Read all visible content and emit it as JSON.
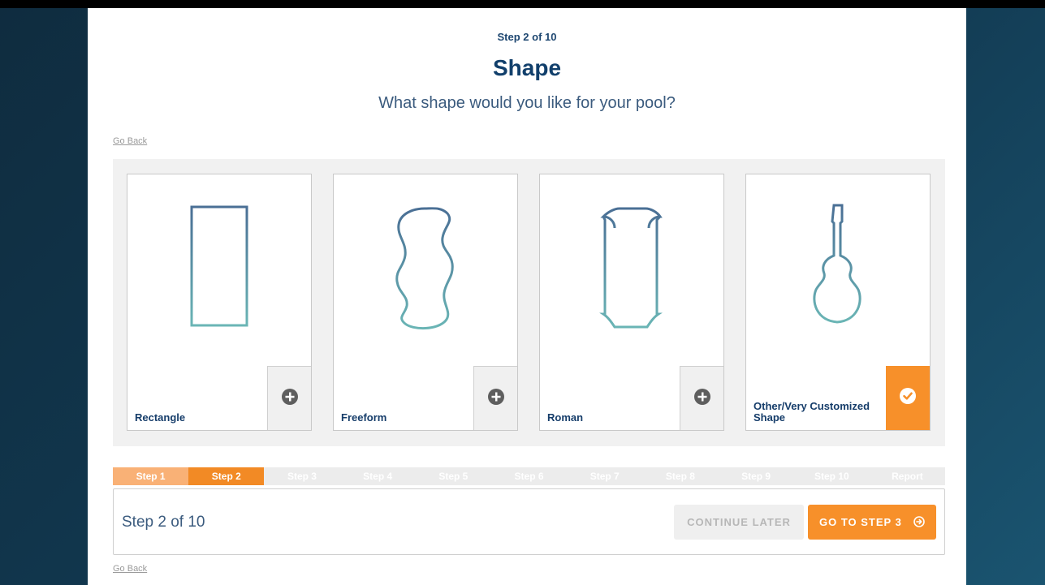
{
  "header": {
    "step_label": "Step 2 of 10",
    "title": "Shape",
    "subtitle": "What shape would you like for your pool?",
    "go_back": "Go Back"
  },
  "cards": [
    {
      "label": "Rectangle",
      "icon": "rectangle-pool-icon",
      "selected": false
    },
    {
      "label": "Freeform",
      "icon": "freeform-pool-icon",
      "selected": false
    },
    {
      "label": "Roman",
      "icon": "roman-pool-icon",
      "selected": false
    },
    {
      "label": "Other/Very Customized Shape",
      "icon": "guitar-pool-icon",
      "selected": true
    }
  ],
  "progress": {
    "steps": [
      "Step 1",
      "Step 2",
      "Step 3",
      "Step 4",
      "Step 5",
      "Step 6",
      "Step 7",
      "Step 8",
      "Step 9",
      "Step 10",
      "Report"
    ],
    "current_index": 1
  },
  "footer": {
    "step_text": "Step 2 of 10",
    "continue_later": "CONTINUE LATER",
    "next_button": "GO TO STEP 3",
    "go_back": "Go Back"
  },
  "colors": {
    "accent": "#f7902a",
    "accent_light": "#f9b176",
    "title": "#113f6b",
    "shape_gradient_top": "#4a6f95",
    "shape_gradient_bottom": "#6ab5b5"
  }
}
